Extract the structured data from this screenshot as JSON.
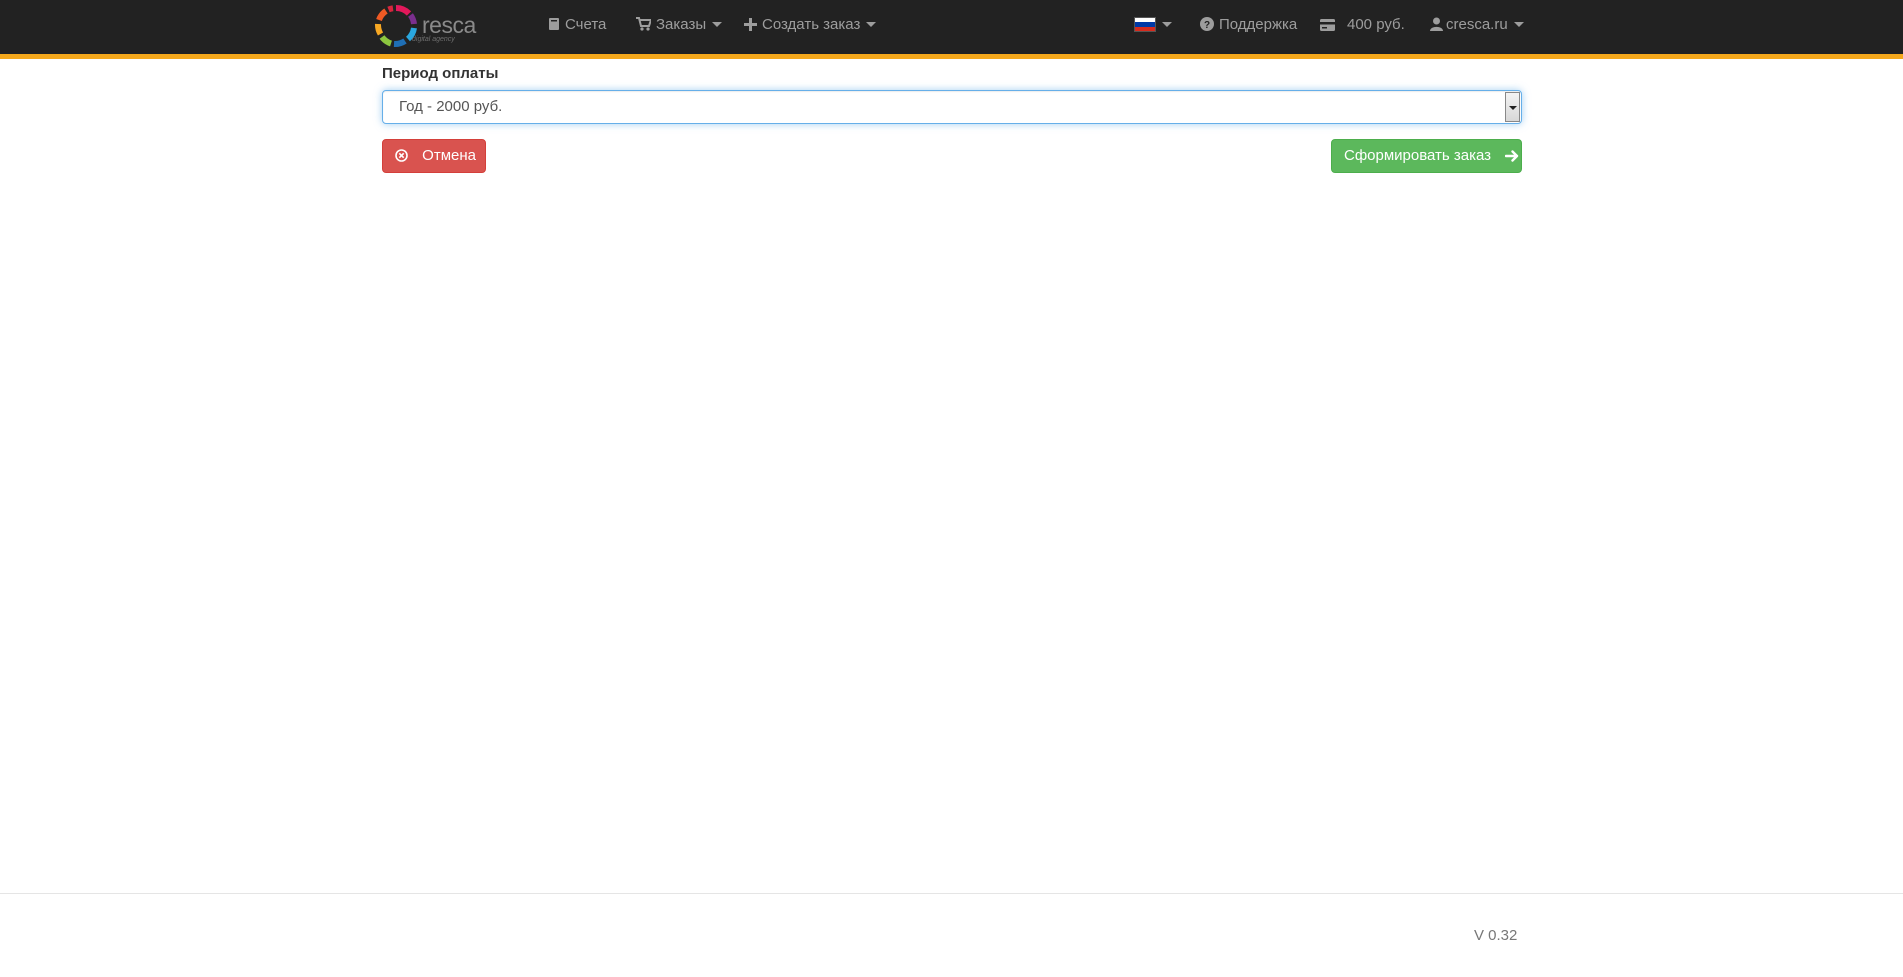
{
  "brand": {
    "name": "resca",
    "tagline": "digital agency"
  },
  "nav": {
    "invoices": {
      "label": "Счета",
      "icon": "book-icon"
    },
    "orders": {
      "label": "Заказы",
      "icon": "shopping-cart-icon"
    },
    "create_order": {
      "label": "Создать заказ",
      "icon": "plus-icon"
    },
    "language": {
      "icon": "russian-flag-icon"
    },
    "support": {
      "label": "Поддержка",
      "icon": "question-circle-icon"
    },
    "balance": {
      "label": "400 руб.",
      "icon": "credit-card-icon"
    },
    "account": {
      "label": "cresca.ru",
      "icon": "user-icon"
    }
  },
  "form": {
    "period_label": "Период оплаты",
    "period_value": "Год - 2000 руб.",
    "cancel_label": "Отмена",
    "submit_label": "Сформировать заказ"
  },
  "footer": {
    "version": "V 0.32"
  },
  "colors": {
    "navbar_bg": "#222222",
    "accent_stripe": "#f5a81c",
    "danger": "#d9534f",
    "success": "#5cb85c",
    "nav_text": "#9d9d9d"
  }
}
